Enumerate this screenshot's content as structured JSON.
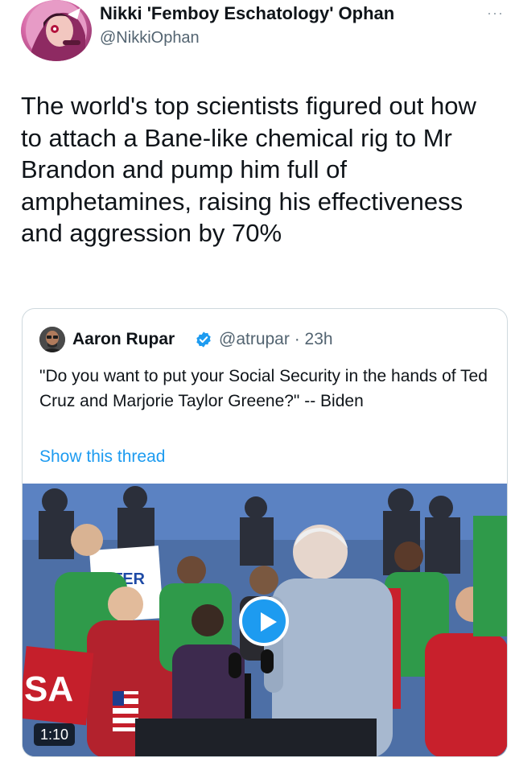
{
  "author": {
    "name": "Nikki 'Femboy Eschatology' Ophan",
    "handle": "@NikkiOphan",
    "avatar_icon": "avatar"
  },
  "more_label": "···",
  "tweet": {
    "text": "The world's top scientists figured out how to attach a Bane-like chemical rig to Mr Brandon and pump him full of amphetamines, raising his effectiveness and aggression by 70%"
  },
  "quote": {
    "name": "Aaron Rupar",
    "handle_time": "@atrupar · 23h",
    "verified_icon": "verified-badge-icon",
    "text": "\"Do you want to put your Social Security in the hands of Ted Cruz and Marjorie Taylor Greene?\" -- Biden",
    "show_thread": "Show this thread",
    "video": {
      "duration": "1:10",
      "sign_text_1": "TER",
      "sign_text_2": "SA"
    }
  },
  "colors": {
    "link": "#1d9bf0",
    "muted": "#536471",
    "border": "#cfd9de",
    "text": "#0f1419"
  }
}
